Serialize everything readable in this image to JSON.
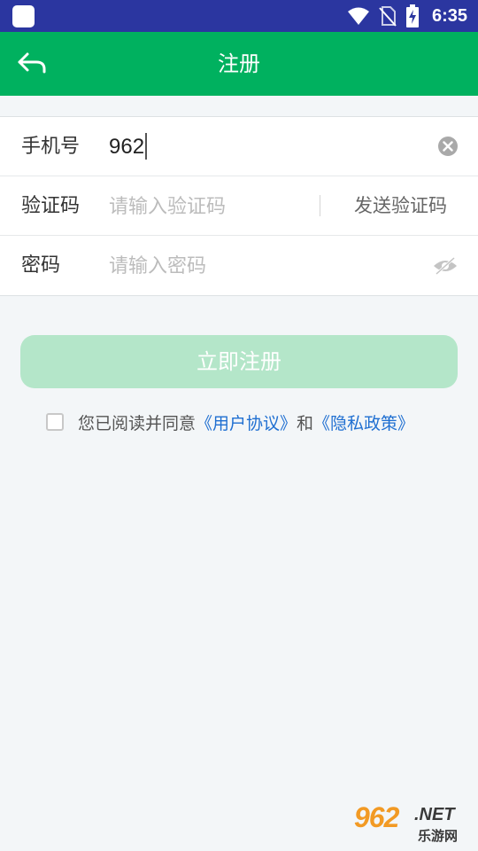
{
  "status_bar": {
    "time": "6:35",
    "icons": [
      "app-icon",
      "wifi-icon",
      "no-sim-icon",
      "battery-charging-icon"
    ],
    "background": "#2b36a0"
  },
  "app_bar": {
    "title": "注册",
    "back_icon": "back-arrow-icon",
    "background": "#00b15f"
  },
  "form": {
    "phone": {
      "label": "手机号",
      "value": "962",
      "clear_icon": "clear-circle-icon"
    },
    "code": {
      "label": "验证码",
      "placeholder": "请输入验证码",
      "send_button": "发送验证码"
    },
    "password": {
      "label": "密码",
      "placeholder": "请输入密码",
      "toggle_icon": "eye-hidden-icon"
    }
  },
  "register_button": {
    "label": "立即注册",
    "color": "#b4e6c9"
  },
  "agreement": {
    "checked": false,
    "text": "您已阅读并同意",
    "user_agreement": "《用户协议》",
    "conjunction": "和",
    "privacy_policy": "《隐私政策》",
    "link_color": "#1f6fd1"
  },
  "watermark": {
    "number": "962",
    "domain": ".NET",
    "site_name": "乐游网"
  }
}
